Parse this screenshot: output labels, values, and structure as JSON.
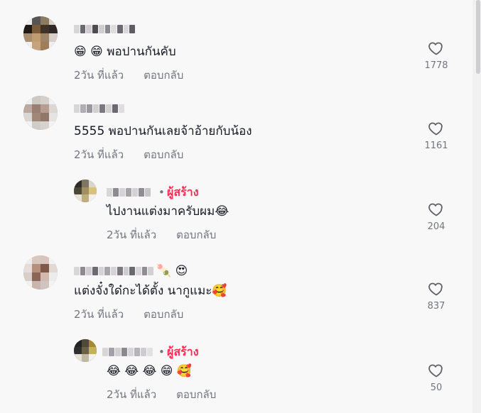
{
  "comments": [
    {
      "text": "😁 😁 พอปานกันคับ",
      "time": "2วัน ที่แล้ว",
      "reply": "ตอบกลับ",
      "likes": "1778"
    },
    {
      "text": "5555 พอปานกันเลยจ้าอ้ายกับน้อง",
      "time": "2วัน ที่แล้ว",
      "reply": "ตอบกลับ",
      "likes": "1161"
    },
    {
      "author_separator": "•",
      "creator_label": "ผู้สร้าง",
      "text": "ไปงานแต่งมาครับผม😂",
      "time": "2วัน ที่แล้ว",
      "reply": "ตอบกลับ",
      "likes": "204"
    },
    {
      "name_suffix": "🍡 😍",
      "text": "แต่งจั๋งใด๋กะได้ตั้ง นากูแมะ🥰",
      "time": "2วัน ที่แล้ว",
      "reply": "ตอบกลับ",
      "likes": "837"
    },
    {
      "author_separator": "•",
      "creator_label": "ผู้สร้าง",
      "text": "😂 😂 😂 😁 🥰",
      "time": "2วัน ที่แล้ว",
      "reply": "ตอบกลับ",
      "likes": "50"
    }
  ],
  "colors": {
    "background": "#f8f8f8",
    "text": "#161823",
    "secondary": "#73757f",
    "creator_badge": "#fe2c55"
  }
}
